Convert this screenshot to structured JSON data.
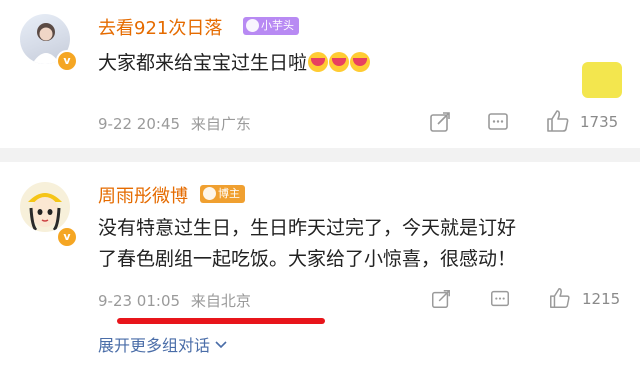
{
  "comments": [
    {
      "username": "去看921次日落",
      "badge": "小芋头",
      "text": "大家都来给宝宝过生日啦",
      "time": "9-22 20:45",
      "location": "来自广东",
      "likes": "1735"
    },
    {
      "username": "周雨彤微博",
      "badge": "博主",
      "text_line1": "没有特意过生日，生日昨天过完了，今天就是订好",
      "text_line2": "了春色剧组一起吃饭。大家给了小惊喜，很感动！",
      "time": "9-23 01:05",
      "location": "来自北京",
      "likes": "1215"
    }
  ],
  "expand_link": "展开更多组对话",
  "colors": {
    "username": "#e56b00",
    "link": "#4a6da8",
    "highlight": "#e8151b"
  }
}
